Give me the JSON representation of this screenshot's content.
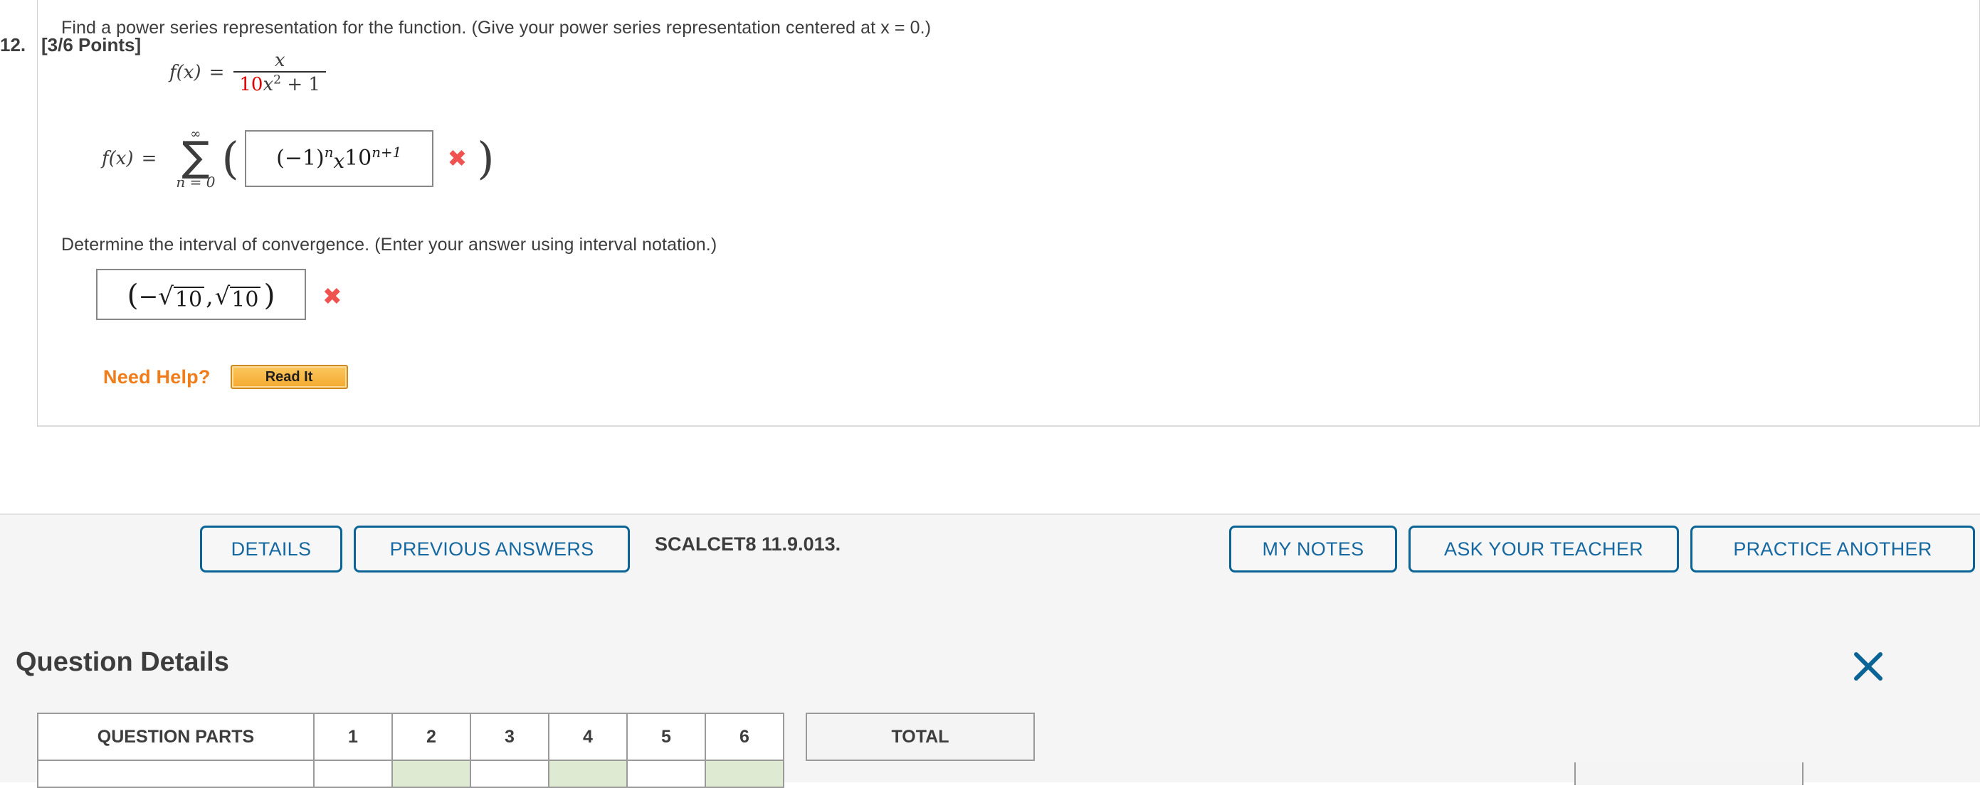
{
  "question_card": {
    "prompt_1": "Find a power series representation for the function. (Give your power series representation centered at x = 0.)",
    "prompt_2": "Determine the interval of convergence. (Enter your answer using interval notation.)",
    "function_display": {
      "label": "f(x)",
      "equals": "=",
      "numerator": "x",
      "denominator_coefficient": "10",
      "denominator_rest_base": "x",
      "denominator_exponent": "2",
      "denominator_tail": " + 1",
      "coefficient_color": "#e00000",
      "plain_text": "f(x) = x / (10x^2 + 1)"
    },
    "series_answer": {
      "label": "f(x)",
      "equals": "=",
      "sigma_upper": "∞",
      "sigma_glyph": "∑",
      "sigma_lower": "n = 0",
      "open_paren": "(",
      "close_paren": ")",
      "value": "(−1)ⁿx10ⁿ⁺¹",
      "value_parts": {
        "neg_one": "(−1)",
        "exp_n": "n",
        "x": "x",
        "ten": "10",
        "ten_exp": "n+1"
      },
      "status_mark": "✖",
      "status_color": "#ef5350",
      "status_meaning": "incorrect"
    },
    "interval_answer": {
      "value": "(−√10 , √10 )",
      "left_open_paren": "(",
      "minus": "−",
      "radical": "√",
      "radicand_left": "10",
      "comma": ",",
      "radicand_right": "10",
      "right_paren": ")",
      "status_mark": "✖",
      "status_color": "#ef5350",
      "status_meaning": "incorrect"
    },
    "need_help": {
      "label": "Need Help?",
      "label_color": "#f07d1a",
      "read_it_button": "Read It"
    }
  },
  "question_header": {
    "number": "12.",
    "points": "[3/6 Points]",
    "details_button": "DETAILS",
    "previous_answers_button": "PREVIOUS ANSWERS",
    "question_code": "SCALCET8 11.9.013.",
    "my_notes_button": "MY NOTES",
    "ask_your_teacher_button": "ASK YOUR TEACHER",
    "practice_another_button": "PRACTICE ANOTHER",
    "accent_color": "#0a6496"
  },
  "question_details": {
    "title": "Question Details",
    "close_icon": "close-icon",
    "table": {
      "row_label": "QUESTION PARTS",
      "part_numbers": [
        "1",
        "2",
        "3",
        "4",
        "5",
        "6"
      ],
      "part_states": [
        "blank",
        "scored",
        "blank",
        "scored",
        "blank",
        "scored"
      ],
      "scored_color": "#dfead2",
      "total_label": "TOTAL"
    }
  }
}
